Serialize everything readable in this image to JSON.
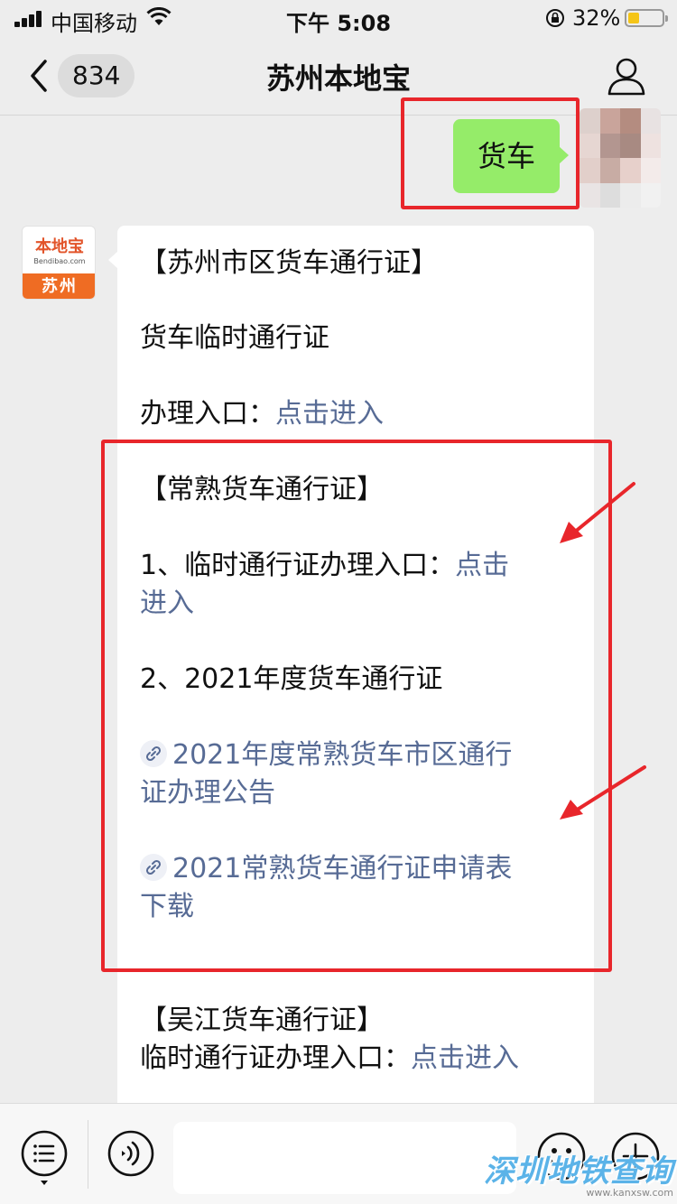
{
  "status_bar": {
    "carrier": "中国移动",
    "time": "下午 5:08",
    "battery": "32%"
  },
  "nav": {
    "unread_count": "834",
    "title": "苏州本地宝"
  },
  "outgoing_message": {
    "text": "货车"
  },
  "bot_avatar": {
    "logo_name": "本地宝",
    "logo_domain": "Bendibao.com",
    "city": "苏州"
  },
  "incoming_message": {
    "suzhou_heading": "【苏州市区货车通行证】",
    "temp_pass_title": "货车临时通行证",
    "apply_label": "办理入口：",
    "apply_link": "点击进入",
    "changshu_heading": "【常熟货车通行证】",
    "changshu_item1_text": "1、临时通行证办理入口：",
    "changshu_item1_link_a": "点击",
    "changshu_item1_link_b": "进入",
    "changshu_item2_text": "2、2021年度货车通行证",
    "article1_line1": "2021年度常熟货车市区通行",
    "article1_line2": "证办理公告",
    "article2_line1": "2021常熟货车通行证申请表",
    "article2_line2": "下载",
    "wujiang_heading": "【吴江货车通行证】",
    "wujiang_text": "临时通行证办理入口：",
    "wujiang_link": "点击进入"
  },
  "watermark": {
    "text": "深圳地铁查询",
    "url": "www.kanxsw.com"
  },
  "colors": {
    "chat_background": "#ededed",
    "outgoing_bubble": "#95ec69",
    "link": "#576b95",
    "highlight": "#e8262b"
  }
}
